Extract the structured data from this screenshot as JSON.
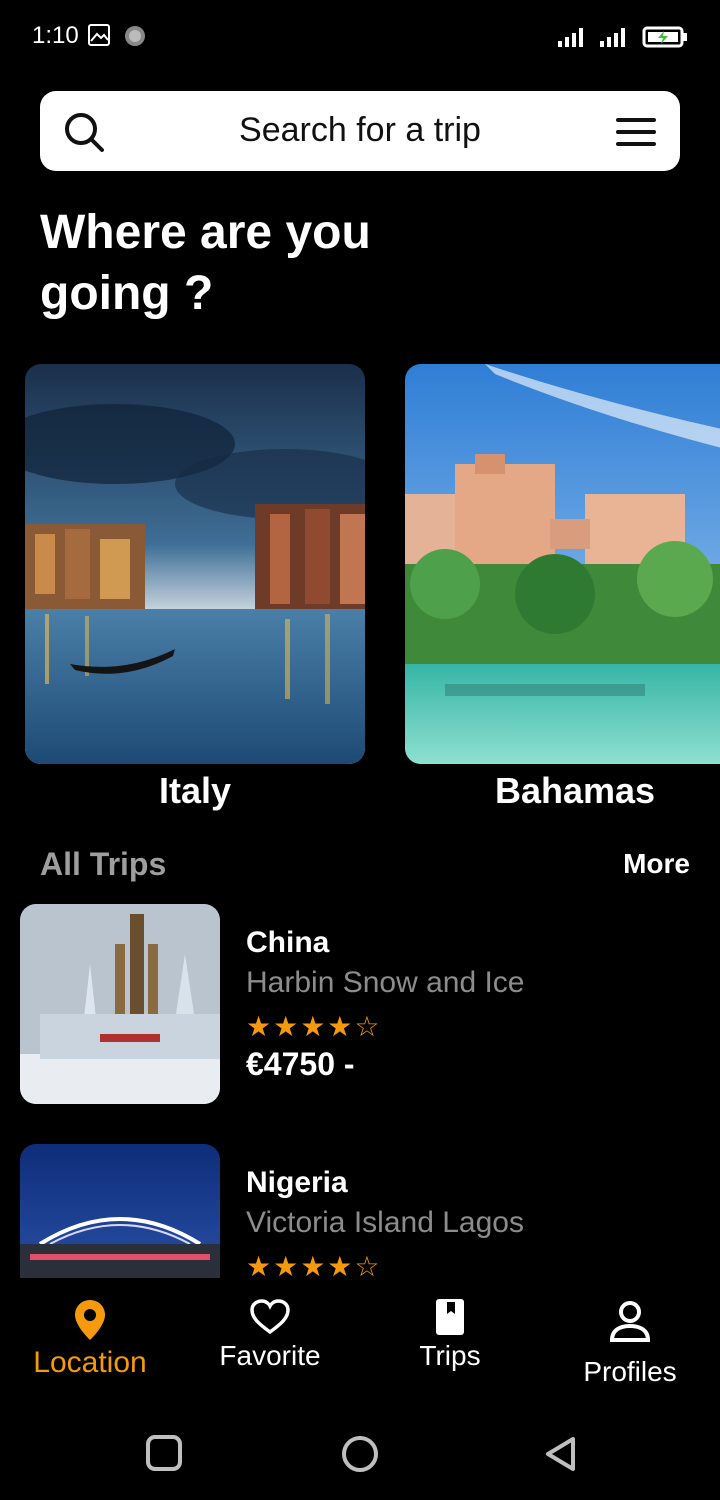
{
  "status_bar": {
    "time": "1:10"
  },
  "search": {
    "placeholder": "Search for a trip"
  },
  "headline": "Where are you going ?",
  "destinations": [
    {
      "label": "Italy"
    },
    {
      "label": "Bahamas"
    }
  ],
  "all_trips": {
    "title": "All Trips",
    "more_label": "More",
    "items": [
      {
        "country": "China",
        "place": "Harbin Snow and Ice",
        "stars": "★★★★☆",
        "price": "€4750 -"
      },
      {
        "country": "Nigeria",
        "place": "Victoria Island Lagos",
        "stars": "★★★★☆",
        "price": ""
      }
    ]
  },
  "bottom_nav": {
    "items": [
      {
        "label": "Location",
        "icon": "location-pin-icon"
      },
      {
        "label": "Favorite",
        "icon": "heart-icon"
      },
      {
        "label": "Trips",
        "icon": "book-icon"
      },
      {
        "label": "Profiles",
        "icon": "person-icon"
      }
    ]
  },
  "colors": {
    "accent": "#f59a0c",
    "muted_text": "#8c8c8c",
    "background": "#000000"
  }
}
